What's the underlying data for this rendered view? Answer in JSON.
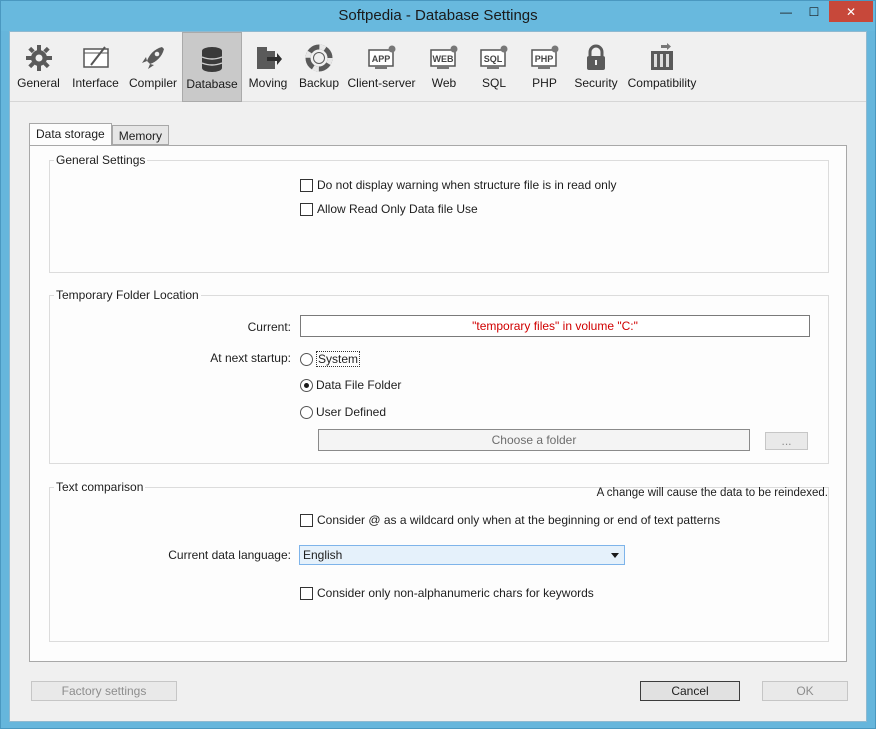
{
  "window": {
    "title": "Softpedia - Database Settings",
    "minimize_glyph": "—",
    "maximize_glyph": "☐",
    "close_glyph": "✕"
  },
  "toolbar": {
    "items": [
      {
        "label": "General",
        "icon": "gear-icon"
      },
      {
        "label": "Interface",
        "icon": "interface-icon"
      },
      {
        "label": "Compiler",
        "icon": "rocket-icon"
      },
      {
        "label": "Database",
        "icon": "database-icon",
        "selected": true
      },
      {
        "label": "Moving",
        "icon": "moving-icon"
      },
      {
        "label": "Backup",
        "icon": "lifebuoy-icon"
      },
      {
        "label": "Client-server",
        "icon": "app-icon"
      },
      {
        "label": "Web",
        "icon": "web-icon"
      },
      {
        "label": "SQL",
        "icon": "sql-icon"
      },
      {
        "label": "PHP",
        "icon": "php-icon"
      },
      {
        "label": "Security",
        "icon": "padlock-icon"
      },
      {
        "label": "Compatibility",
        "icon": "compatibility-icon"
      }
    ]
  },
  "tabs": [
    {
      "label": "Data storage",
      "active": true
    },
    {
      "label": "Memory",
      "active": false
    }
  ],
  "general_settings": {
    "title": "General Settings",
    "no_warning_label": "Do not display warning when structure file is in read only",
    "allow_read_only_label": "Allow Read Only Data file Use"
  },
  "temp_folder": {
    "title": "Temporary Folder Location",
    "current_label": "Current:",
    "current_value": "\"temporary files\" in volume \"C:\"",
    "next_startup_label": "At next startup:",
    "options": [
      "System",
      "Data File Folder",
      "User Defined"
    ],
    "selected_option": "Data File Folder",
    "folder_button": "Choose a folder",
    "browse_button": "..."
  },
  "text_comparison": {
    "title": "Text comparison",
    "note": "A change will cause the data to be reindexed.",
    "wildcard_label": "Consider @ as a wildcard only when at the beginning or end of text patterns",
    "language_label": "Current data language:",
    "language_value": "English",
    "non_alnum_label": "Consider only non-alphanumeric chars for keywords"
  },
  "footer": {
    "factory_settings": "Factory settings",
    "cancel": "Cancel",
    "ok": "OK"
  },
  "colors": {
    "titlebar": "#68b9de",
    "accent_red": "#d00000",
    "selected_tab_bg": "#c9c9c9"
  }
}
